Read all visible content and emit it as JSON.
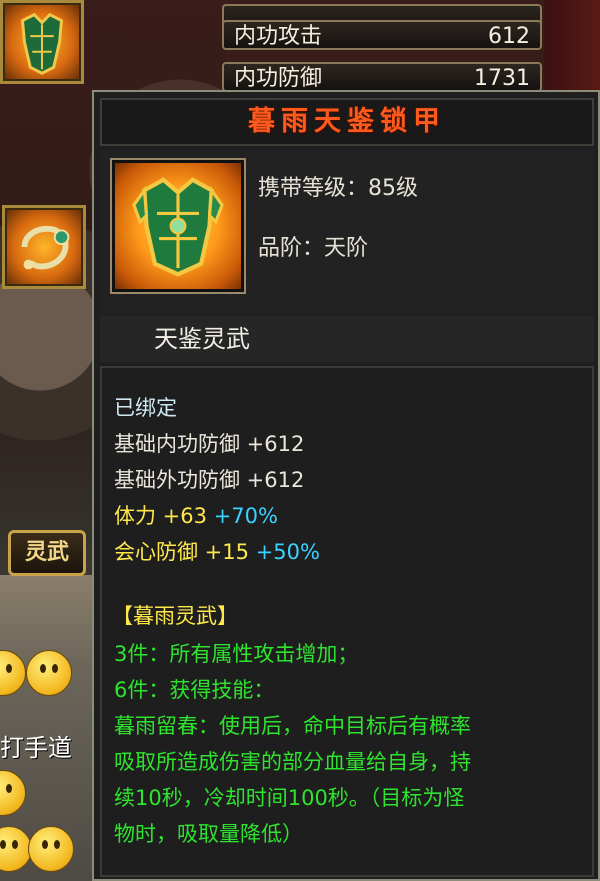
{
  "stats": [
    {
      "label": "内功攻击",
      "value": "612"
    },
    {
      "label": "内功防御",
      "value": "1731"
    }
  ],
  "left_panel": {
    "lingwu_button": "灵武",
    "partial_text": "打手道"
  },
  "tooltip": {
    "title": "暮雨天鉴锁甲",
    "carry_level": "携带等级：85级",
    "grade": "品阶：天阶",
    "series": "天鉴灵武",
    "bound": "已绑定",
    "attrs": [
      {
        "text": "基础内功防御  +612"
      },
      {
        "text": "基础外功防御  +612"
      },
      {
        "text": "体力  +63",
        "bonus": "+70%"
      },
      {
        "text": "会心防御  +15",
        "bonus": "+50%"
      }
    ],
    "set_name": "【暮雨灵武】",
    "set_lines": [
      "3件：所有属性攻击增加；",
      "6件：获得技能：",
      "暮雨留春：使用后，命中目标后有概率",
      "吸取所造成伤害的部分血量给自身，持",
      "续10秒，冷却时间100秒。（目标为怪",
      "物时，吸取量降低）"
    ]
  },
  "colors": {
    "title": "#ff5a1e",
    "attr_yellow": "#ffe94a",
    "bonus_cyan": "#3ad2ff",
    "set_green": "#2ee42e"
  },
  "icons": [
    "armor-icon",
    "bracelet-icon",
    "smiley-icon"
  ]
}
